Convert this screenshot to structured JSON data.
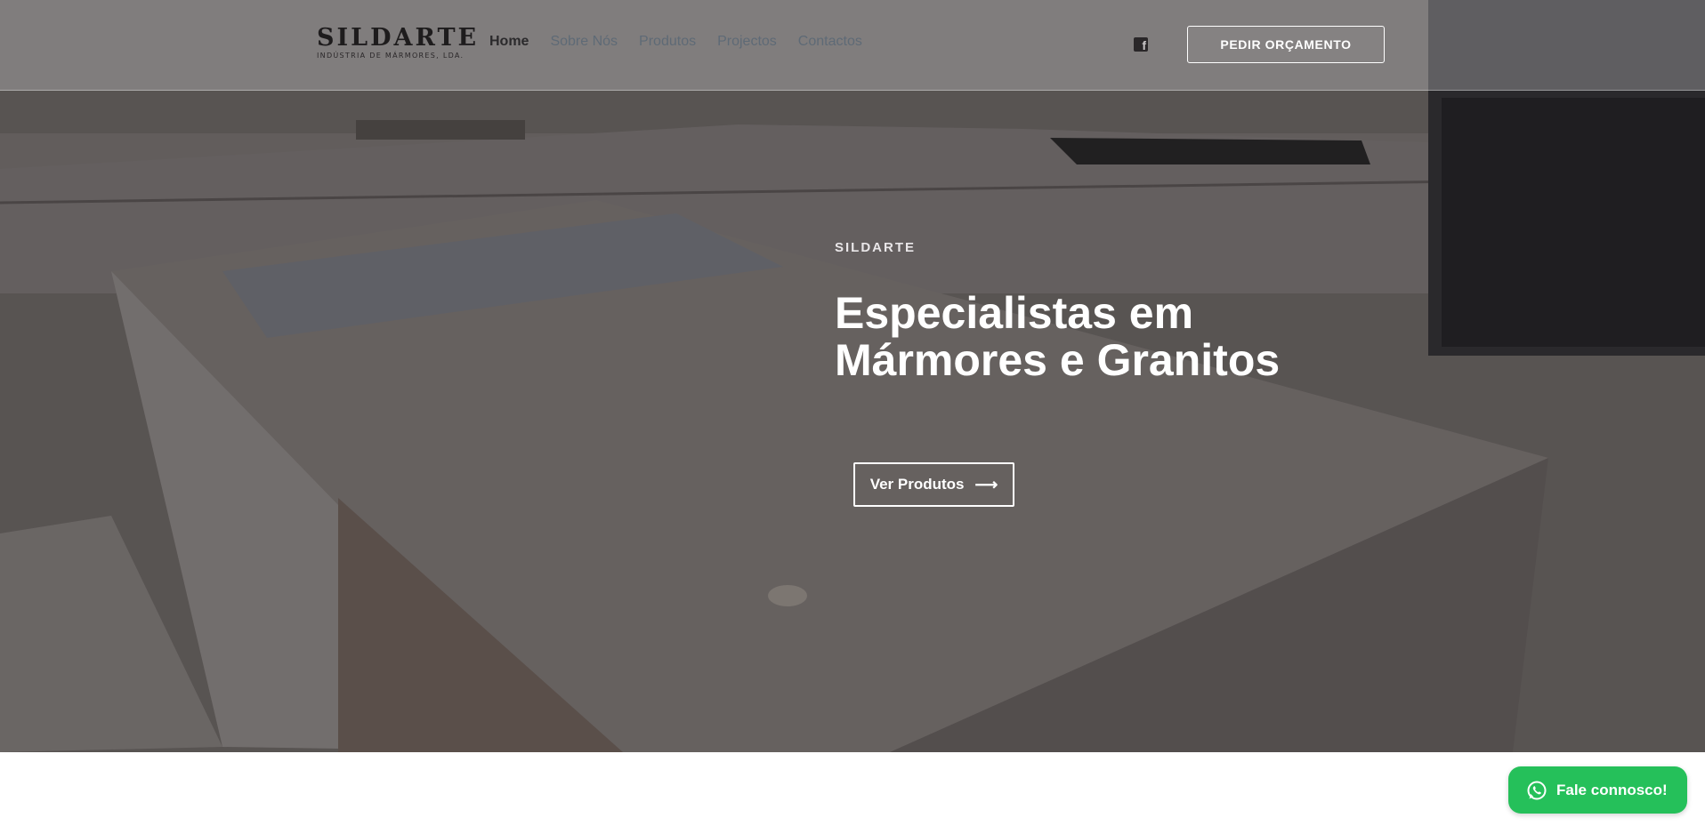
{
  "header": {
    "logo": {
      "name": "SILDARTE",
      "tagline": "INDÚSTRIA DE MÁRMORES, LDA."
    },
    "nav": [
      {
        "label": "Home",
        "active": true
      },
      {
        "label": "Sobre Nós",
        "active": false
      },
      {
        "label": "Produtos",
        "active": false
      },
      {
        "label": "Projectos",
        "active": false
      },
      {
        "label": "Contactos",
        "active": false
      }
    ],
    "social_icon": "facebook-icon",
    "quote_button": "PEDIR ORÇAMENTO"
  },
  "hero": {
    "eyebrow": "SILDARTE",
    "headline_line1": "Especialistas em",
    "headline_line2": "Mármores e Granitos",
    "cta_label": "Ver Produtos",
    "cta_icon": "arrow-right-icon"
  },
  "floating": {
    "whatsapp_label": "Fale connosco!",
    "whatsapp_icon": "whatsapp-icon",
    "color": "#25c05a"
  }
}
